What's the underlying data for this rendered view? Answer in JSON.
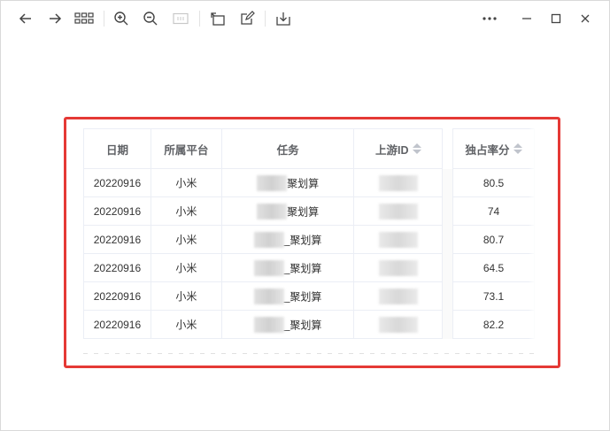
{
  "toolbar": {
    "icons": [
      "arrow-left-icon",
      "arrow-right-icon",
      "grid-icon",
      "zoom-in-icon",
      "zoom-out-icon",
      "fit-icon",
      "rotate-icon",
      "edit-icon",
      "download-icon"
    ],
    "window_controls": [
      "more-icon",
      "minimize-icon",
      "maximize-icon",
      "close-icon"
    ]
  },
  "table": {
    "headers": {
      "date": "日期",
      "platform": "所属平台",
      "task": "任务",
      "upstream_id": "上游ID",
      "exclusive_rate": "独占率分"
    },
    "rows": [
      {
        "date": "20220916",
        "platform": "小米",
        "task_suffix": "聚划算",
        "rate": "80.5"
      },
      {
        "date": "20220916",
        "platform": "小米",
        "task_suffix": "聚划算",
        "rate": "74"
      },
      {
        "date": "20220916",
        "platform": "小米",
        "task_suffix": "_聚划算",
        "rate": "80.7"
      },
      {
        "date": "20220916",
        "platform": "小米",
        "task_suffix": "_聚划算",
        "rate": "64.5"
      },
      {
        "date": "20220916",
        "platform": "小米",
        "task_suffix": "_聚划算",
        "rate": "73.1"
      },
      {
        "date": "20220916",
        "platform": "小米",
        "task_suffix": "_聚划算",
        "rate": "82.2"
      }
    ]
  },
  "colors": {
    "highlight_border": "#e53935",
    "header_text": "#606266",
    "cell_border": "#ebeef5"
  }
}
